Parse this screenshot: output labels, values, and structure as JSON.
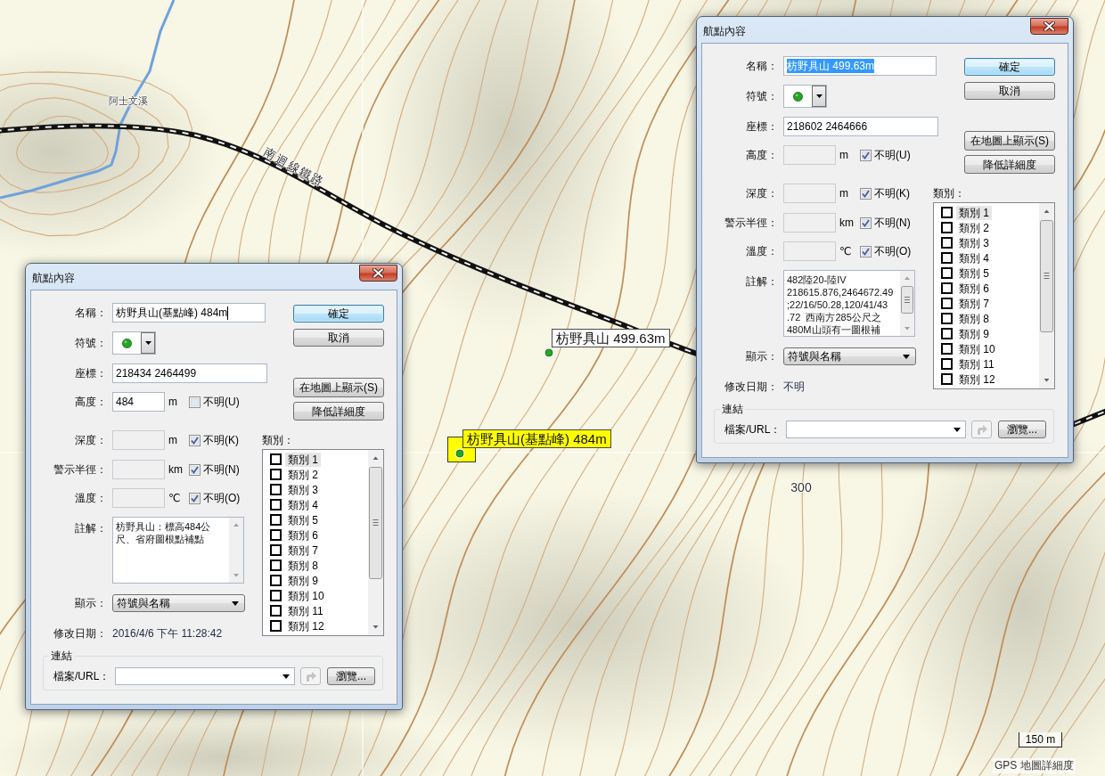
{
  "map": {
    "labels": [
      {
        "kind": "stream",
        "text": "阿士文溪"
      },
      {
        "kind": "railway",
        "text": "南迴線鐵路"
      },
      {
        "kind": "contour",
        "text": "300"
      }
    ],
    "waypoints": [
      {
        "label": "枋野具山 499.63m",
        "selected": false
      },
      {
        "label": "枋野具山(基點峰) 484m",
        "selected": true
      }
    ],
    "scale": {
      "distance": "150 m",
      "caption": "GPS 地圖詳細度"
    }
  },
  "dialogs": [
    {
      "title": "航點內容",
      "name": {
        "label": "名稱：",
        "value": "枋野具山 499.63m",
        "text_selected": true,
        "caret": false
      },
      "symbol": {
        "label": "符號："
      },
      "coordinates": {
        "label": "座標：",
        "value": "218602 2464666"
      },
      "measures": [
        {
          "label": "高度：",
          "unit": "m",
          "unknown": {
            "label": "不明(U)",
            "checked": true
          }
        },
        {
          "label": "深度：",
          "unit": "m",
          "unknown": {
            "label": "不明(K)",
            "checked": true
          }
        },
        {
          "label": "警示半徑：",
          "unit": "km",
          "unknown": {
            "label": "不明(N)",
            "checked": true
          }
        },
        {
          "label": "溫度：",
          "unit": "℃",
          "unknown": {
            "label": "不明(O)",
            "checked": true
          }
        }
      ],
      "comment": {
        "label": "註解：",
        "value": "482陸20-陸IV\n218615.876,2464672.49\n;22/16/50.28,120/41/43\n.72  西南方285公尺之\n480M山頭有一圖根補"
      },
      "display": {
        "label": "顯示：",
        "value": "符號與名稱"
      },
      "modified": {
        "label": "修改日期：",
        "value": "不明"
      },
      "buttons": [
        {
          "label": "確定",
          "default": true
        },
        {
          "label": "取消",
          "default": false
        },
        {
          "label": "在地圖上顯示(S)",
          "default": false
        },
        {
          "label": "降低詳細度",
          "default": false
        }
      ],
      "categories": {
        "label": "類別：",
        "items": [
          {
            "label": "類別 1",
            "checked": false,
            "selected": true
          },
          {
            "label": "類別 2",
            "checked": false,
            "selected": false
          },
          {
            "label": "類別 3",
            "checked": false,
            "selected": false
          },
          {
            "label": "類別 4",
            "checked": false,
            "selected": false
          },
          {
            "label": "類別 5",
            "checked": false,
            "selected": false
          },
          {
            "label": "類別 6",
            "checked": false,
            "selected": false
          },
          {
            "label": "類別 7",
            "checked": false,
            "selected": false
          },
          {
            "label": "類別 8",
            "checked": false,
            "selected": false
          },
          {
            "label": "類別 9",
            "checked": false,
            "selected": false
          },
          {
            "label": "類別 10",
            "checked": false,
            "selected": false
          },
          {
            "label": "類別 11",
            "checked": false,
            "selected": false
          },
          {
            "label": "類別 12",
            "checked": false,
            "selected": false
          }
        ]
      },
      "link": {
        "title": "連結",
        "file_label": "檔案/URL：",
        "browse": "瀏覽..."
      }
    },
    {
      "title": "航點內容",
      "name": {
        "label": "名稱：",
        "value": "枋野具山(基點峰) 484m",
        "text_selected": false,
        "caret": true
      },
      "symbol": {
        "label": "符號："
      },
      "coordinates": {
        "label": "座標：",
        "value": "218434 2464499"
      },
      "measures": [
        {
          "label": "高度：",
          "value": "484",
          "unit": "m",
          "unknown": {
            "label": "不明(U)",
            "checked": false
          }
        },
        {
          "label": "深度：",
          "unit": "m",
          "unknown": {
            "label": "不明(K)",
            "checked": true
          }
        },
        {
          "label": "警示半徑：",
          "unit": "km",
          "unknown": {
            "label": "不明(N)",
            "checked": true
          }
        },
        {
          "label": "溫度：",
          "unit": "℃",
          "unknown": {
            "label": "不明(O)",
            "checked": true
          }
        }
      ],
      "comment": {
        "label": "註解：",
        "value": "枋野具山：標高484公尺、省府圖根點補點"
      },
      "display": {
        "label": "顯示：",
        "value": "符號與名稱"
      },
      "modified": {
        "label": "修改日期：",
        "value": "2016/4/6 下午 11:28:42"
      },
      "buttons": [
        {
          "label": "確定",
          "default": true
        },
        {
          "label": "取消",
          "default": false
        },
        {
          "label": "在地圖上顯示(S)",
          "default": false
        },
        {
          "label": "降低詳細度",
          "default": false
        }
      ],
      "categories": {
        "label": "類別：",
        "items": [
          {
            "label": "類別 1",
            "checked": false,
            "selected": true
          },
          {
            "label": "類別 2",
            "checked": false,
            "selected": false
          },
          {
            "label": "類別 3",
            "checked": false,
            "selected": false
          },
          {
            "label": "類別 4",
            "checked": false,
            "selected": false
          },
          {
            "label": "類別 5",
            "checked": false,
            "selected": false
          },
          {
            "label": "類別 6",
            "checked": false,
            "selected": false
          },
          {
            "label": "類別 7",
            "checked": false,
            "selected": false
          },
          {
            "label": "類別 8",
            "checked": false,
            "selected": false
          },
          {
            "label": "類別 9",
            "checked": false,
            "selected": false
          },
          {
            "label": "類別 10",
            "checked": false,
            "selected": false
          },
          {
            "label": "類別 11",
            "checked": false,
            "selected": false
          },
          {
            "label": "類別 12",
            "checked": false,
            "selected": false
          }
        ]
      },
      "link": {
        "title": "連結",
        "file_label": "檔案/URL：",
        "browse": "瀏覽..."
      }
    }
  ]
}
